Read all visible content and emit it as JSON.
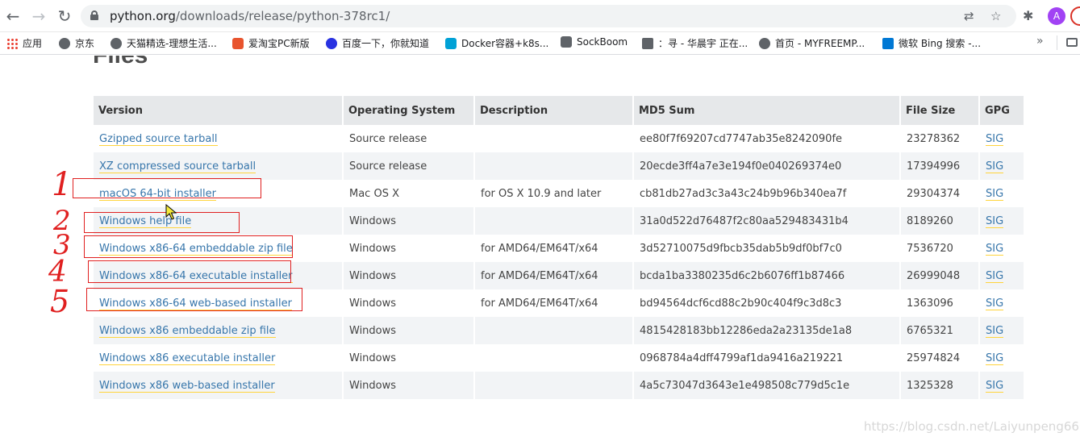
{
  "browser": {
    "url_host": "python.org",
    "url_path": "/downloads/release/python-378rc1/",
    "profile_initial": "A"
  },
  "bookmarks": [
    {
      "label": "应用",
      "color": "#ea4335"
    },
    {
      "label": "京东",
      "color": "#5f6368"
    },
    {
      "label": "天猫精选-理想生活...",
      "color": "#5f6368"
    },
    {
      "label": "爱淘宝PC新版",
      "color": "#e8542e"
    },
    {
      "label": "百度一下，你就知道",
      "color": "#2932e1"
    },
    {
      "label": "Docker容器+k8s...",
      "color": "#00a1d6"
    },
    {
      "label": "SockBoom",
      "color": "#5f6368"
    },
    {
      "label": "：寻 - 华晨宇 正在...",
      "color": "#5f6368"
    },
    {
      "label": "首页 - MYFREEMP...",
      "color": "#5f6368"
    },
    {
      "label": "微软 Bing 搜索 -...",
      "color": "#0078d4"
    }
  ],
  "page": {
    "heading": "Files"
  },
  "table": {
    "headers": [
      "Version",
      "Operating System",
      "Description",
      "MD5 Sum",
      "File Size",
      "GPG"
    ],
    "rows": [
      {
        "version": "Gzipped source tarball",
        "os": "Source release",
        "desc": "",
        "md5": "ee80f7f69207cd7747ab35e8242090fe",
        "size": "23278362",
        "gpg": "SIG"
      },
      {
        "version": "XZ compressed source tarball",
        "os": "Source release",
        "desc": "",
        "md5": "20ecde3ff4a7e3e194f0e040269374e0",
        "size": "17394996",
        "gpg": "SIG"
      },
      {
        "version": "macOS 64-bit installer",
        "os": "Mac OS X",
        "desc": "for OS X 10.9 and later",
        "md5": "cb81db27ad3c3a43c24b9b96b340ea7f",
        "size": "29304374",
        "gpg": "SIG"
      },
      {
        "version": "Windows help file",
        "os": "Windows",
        "desc": "",
        "md5": "31a0d522d76487f2c80aa529483431b4",
        "size": "8189260",
        "gpg": "SIG"
      },
      {
        "version": "Windows x86-64 embeddable zip file",
        "os": "Windows",
        "desc": "for AMD64/EM64T/x64",
        "md5": "3d52710075d9fbcb35dab5b9df0bf7c0",
        "size": "7536720",
        "gpg": "SIG"
      },
      {
        "version": "Windows x86-64 executable installer",
        "os": "Windows",
        "desc": "for AMD64/EM64T/x64",
        "md5": "bcda1ba3380235d6c2b6076ff1b87466",
        "size": "26999048",
        "gpg": "SIG"
      },
      {
        "version": "Windows x86-64 web-based installer",
        "os": "Windows",
        "desc": "for AMD64/EM64T/x64",
        "md5": "bd94564dcf6cd88c2b90c404f9c3d8c3",
        "size": "1363096",
        "gpg": "SIG"
      },
      {
        "version": "Windows x86 embeddable zip file",
        "os": "Windows",
        "desc": "",
        "md5": "4815428183bb12286eda2a23135de1a8",
        "size": "6765321",
        "gpg": "SIG"
      },
      {
        "version": "Windows x86 executable installer",
        "os": "Windows",
        "desc": "",
        "md5": "0968784a4dff4799af1da9416a219221",
        "size": "25974824",
        "gpg": "SIG"
      },
      {
        "version": "Windows x86 web-based installer",
        "os": "Windows",
        "desc": "",
        "md5": "4a5c73047d3643e1e498508c779d5c1e",
        "size": "1325328",
        "gpg": "SIG"
      }
    ]
  },
  "annotations": {
    "color": "#e02020",
    "numbers": [
      "1",
      "2",
      "3",
      "4",
      "5"
    ]
  },
  "watermark": "https://blog.csdn.net/Laiyunpeng666"
}
